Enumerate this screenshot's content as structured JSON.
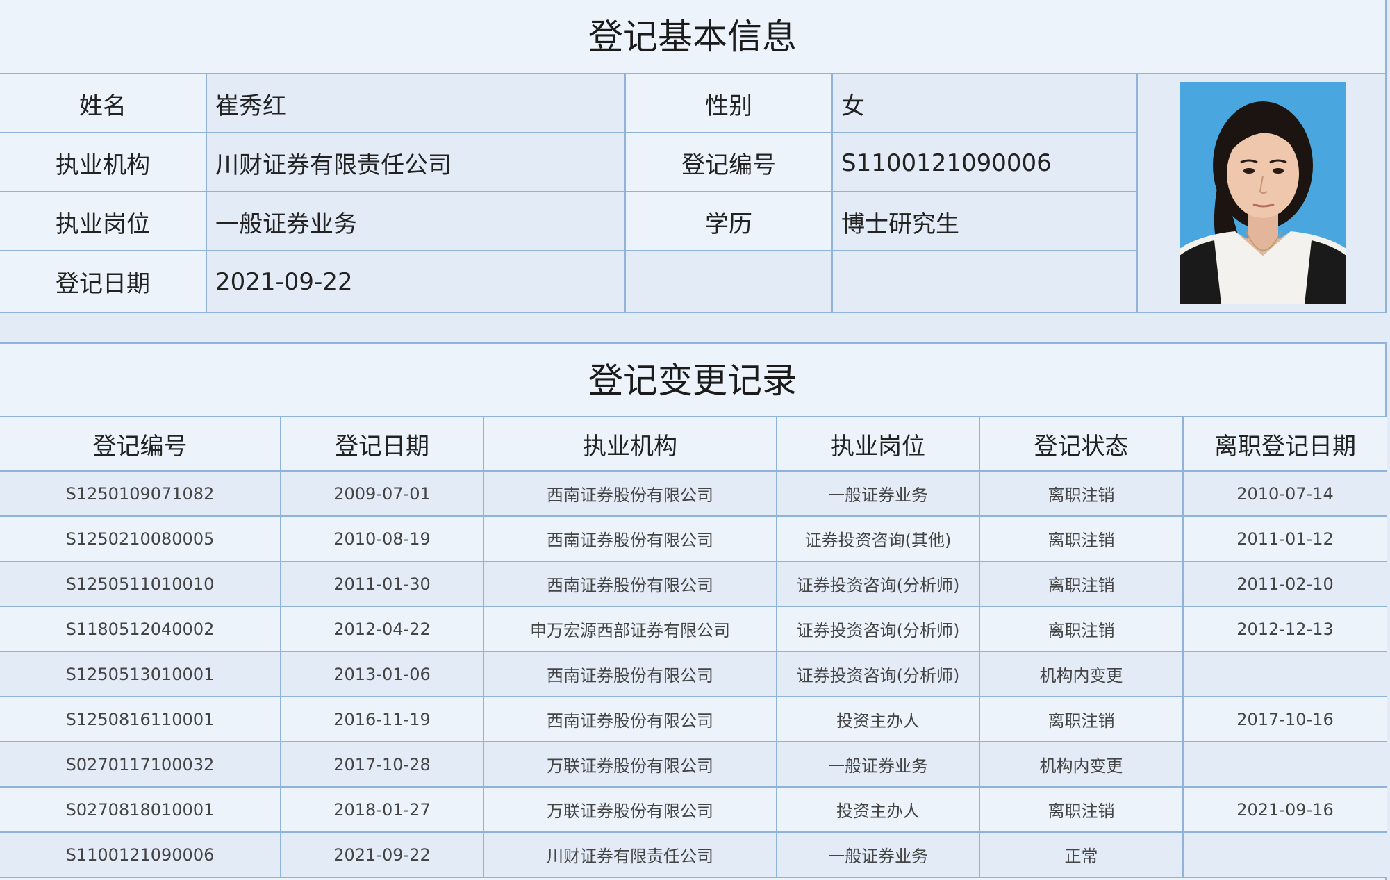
{
  "basic": {
    "title": "登记基本信息",
    "rows": [
      {
        "label1": "姓名",
        "value1": "崔秀红",
        "label2": "性别",
        "value2": "女"
      },
      {
        "label1": "执业机构",
        "value1": "川财证券有限责任公司",
        "label2": "登记编号",
        "value2": "S1100121090006"
      },
      {
        "label1": "执业岗位",
        "value1": "一般证券业务",
        "label2": "学历",
        "value2": "博士研究生"
      },
      {
        "label1": "登记日期",
        "value1": "2021-09-22",
        "label2": "",
        "value2": ""
      }
    ],
    "photo_bg": "#4aa6de"
  },
  "changes": {
    "title": "登记变更记录",
    "headers": [
      "登记编号",
      "登记日期",
      "执业机构",
      "执业岗位",
      "登记状态",
      "离职登记日期"
    ],
    "rows": [
      [
        "S1250109071082",
        "2009-07-01",
        "西南证券股份有限公司",
        "一般证券业务",
        "离职注销",
        "2010-07-14"
      ],
      [
        "S1250210080005",
        "2010-08-19",
        "西南证券股份有限公司",
        "证券投资咨询(其他)",
        "离职注销",
        "2011-01-12"
      ],
      [
        "S1250511010010",
        "2011-01-30",
        "西南证券股份有限公司",
        "证券投资咨询(分析师)",
        "离职注销",
        "2011-02-10"
      ],
      [
        "S1180512040002",
        "2012-04-22",
        "申万宏源西部证券有限公司",
        "证券投资咨询(分析师)",
        "离职注销",
        "2012-12-13"
      ],
      [
        "S1250513010001",
        "2013-01-06",
        "西南证券股份有限公司",
        "证券投资咨询(分析师)",
        "机构内变更",
        ""
      ],
      [
        "S1250816110001",
        "2016-11-19",
        "西南证券股份有限公司",
        "投资主办人",
        "离职注销",
        "2017-10-16"
      ],
      [
        "S0270117100032",
        "2017-10-28",
        "万联证券股份有限公司",
        "一般证券业务",
        "机构内变更",
        ""
      ],
      [
        "S0270818010001",
        "2018-01-27",
        "万联证券股份有限公司",
        "投资主办人",
        "离职注销",
        "2021-09-16"
      ],
      [
        "S1100121090006",
        "2021-09-22",
        "川财证券有限责任公司",
        "一般证券业务",
        "正常",
        ""
      ]
    ]
  },
  "colors": {
    "border": "#8fb3d9",
    "bg_light": "#edf3fa",
    "bg_dark": "#e2ebf6"
  }
}
